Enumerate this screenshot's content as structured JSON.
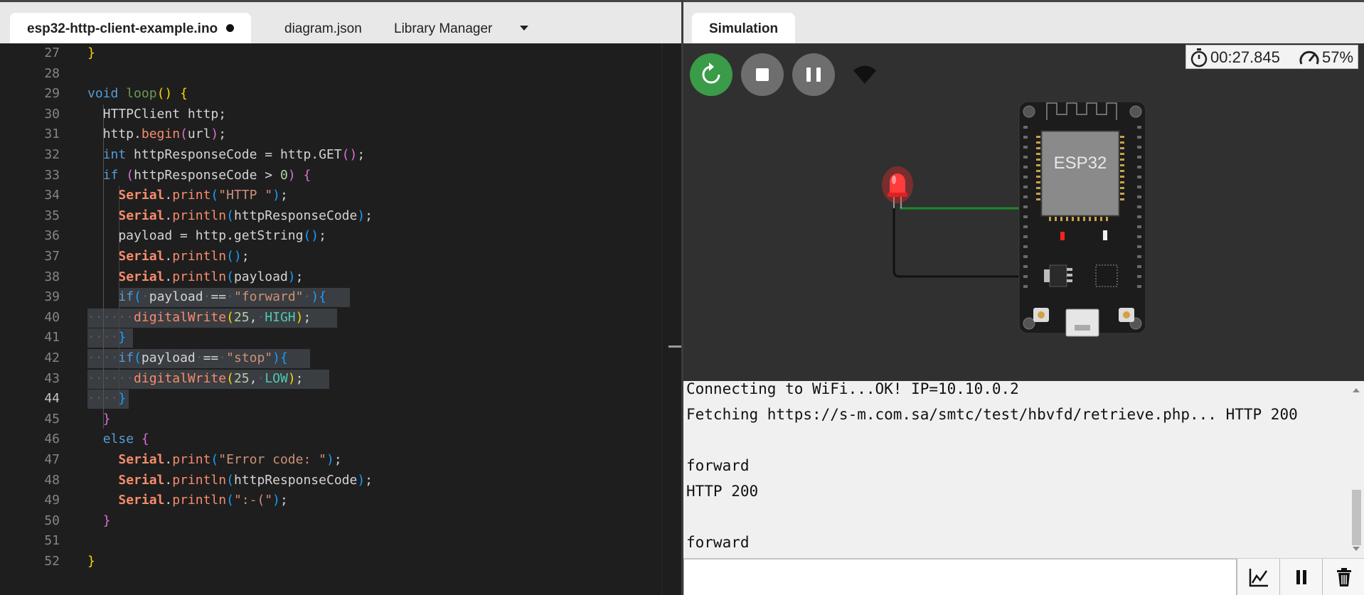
{
  "editor": {
    "tabs": [
      {
        "label": "esp32-http-client-example.ino",
        "active": true,
        "unsaved": true
      },
      {
        "label": "diagram.json",
        "active": false
      },
      {
        "label": "Library Manager",
        "active": false
      }
    ],
    "current_line": 44,
    "lines": [
      {
        "n": 27,
        "text": "}"
      },
      {
        "n": 28,
        "text": ""
      },
      {
        "n": 29,
        "text": "void loop() {"
      },
      {
        "n": 30,
        "text": "  HTTPClient http;"
      },
      {
        "n": 31,
        "text": "  http.begin(url);"
      },
      {
        "n": 32,
        "text": "  int httpResponseCode = http.GET();"
      },
      {
        "n": 33,
        "text": "  if (httpResponseCode > 0) {"
      },
      {
        "n": 34,
        "text": "    Serial.print(\"HTTP \");"
      },
      {
        "n": 35,
        "text": "    Serial.println(httpResponseCode);"
      },
      {
        "n": 36,
        "text": "    payload = http.getString();"
      },
      {
        "n": 37,
        "text": "    Serial.println();"
      },
      {
        "n": 38,
        "text": "    Serial.println(payload);"
      },
      {
        "n": 39,
        "text": "    if( payload == \"forward\" ){"
      },
      {
        "n": 40,
        "text": "      digitalWrite(25, HIGH);"
      },
      {
        "n": 41,
        "text": "    }"
      },
      {
        "n": 42,
        "text": "    if(payload == \"stop\"){"
      },
      {
        "n": 43,
        "text": "      digitalWrite(25, LOW);"
      },
      {
        "n": 44,
        "text": "    }"
      },
      {
        "n": 45,
        "text": "  }"
      },
      {
        "n": 46,
        "text": "  else {"
      },
      {
        "n": 47,
        "text": "    Serial.print(\"Error code: \");"
      },
      {
        "n": 48,
        "text": "    Serial.println(httpResponseCode);"
      },
      {
        "n": 49,
        "text": "    Serial.println(\":-(\");"
      },
      {
        "n": 50,
        "text": "  }"
      },
      {
        "n": 51,
        "text": ""
      },
      {
        "n": 52,
        "text": "}"
      }
    ]
  },
  "simulation": {
    "tab_label": "Simulation",
    "timer": "00:27.845",
    "speed": "57%",
    "board_label": "ESP32",
    "led_color": "#ff2a2a",
    "accent_green": "#3a9b48"
  },
  "serial": {
    "lines": [
      "Connecting to WiFi...OK! IP=10.10.0.2",
      "Fetching https://s-m.com.sa/smtc/test/hbvfd/retrieve.php... HTTP 200",
      "",
      "forward",
      "HTTP 200",
      "",
      "forward"
    ],
    "input_value": ""
  }
}
